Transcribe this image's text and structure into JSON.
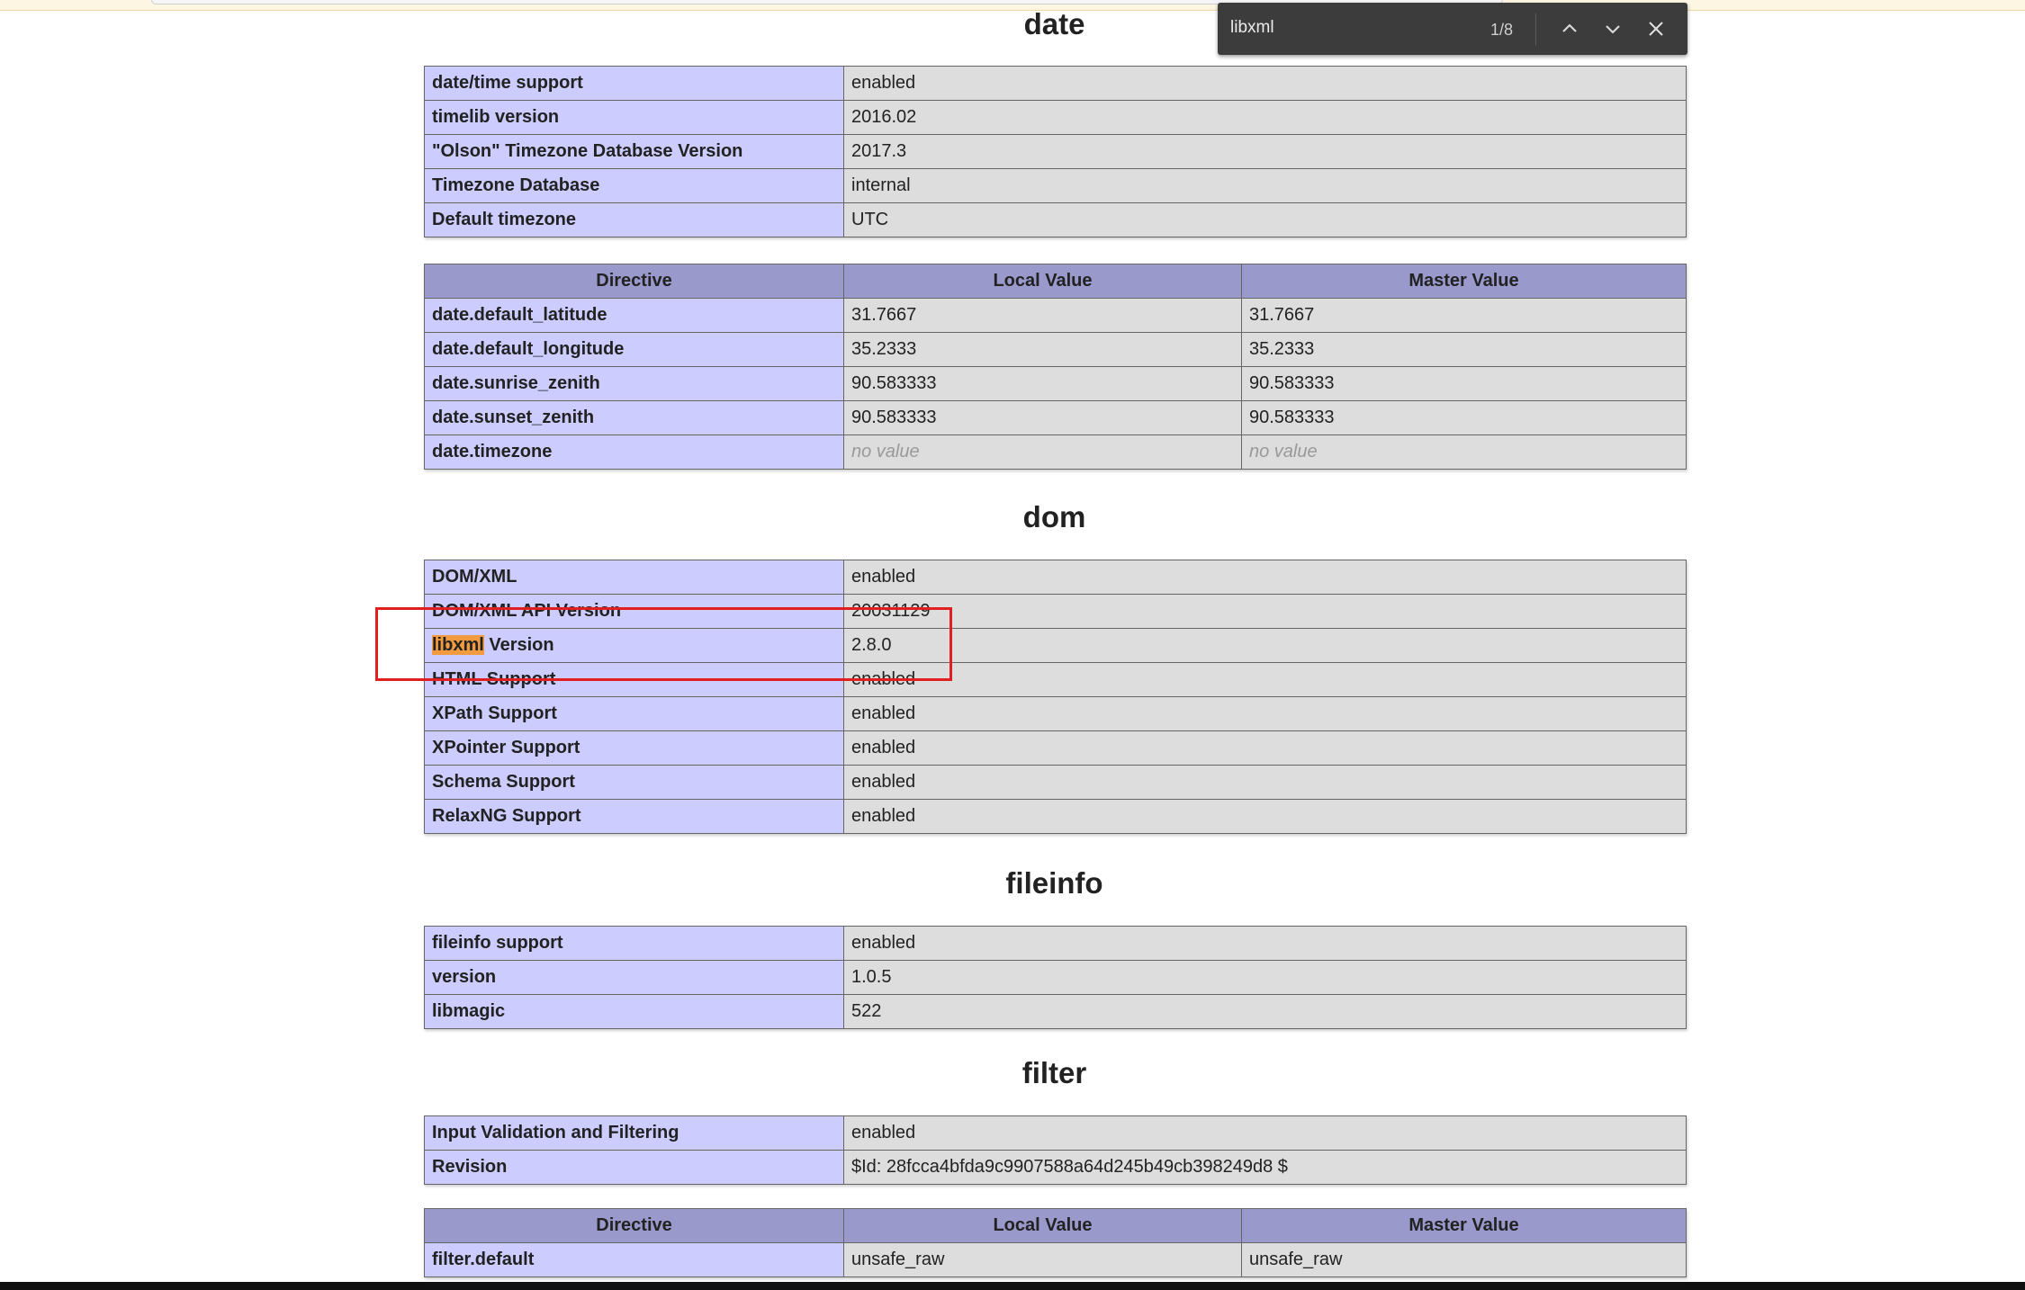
{
  "find_bar": {
    "query": "libxml",
    "match_count": "1/8",
    "prev_icon": "chevron-up-icon",
    "next_icon": "chevron-down-icon",
    "close_icon": "close-icon"
  },
  "sections": {
    "date": {
      "title": "date",
      "info_rows": [
        {
          "key": "date/time support",
          "value": "enabled"
        },
        {
          "key": "timelib version",
          "value": "2016.02"
        },
        {
          "key": "\"Olson\" Timezone Database Version",
          "value": "2017.3"
        },
        {
          "key": "Timezone Database",
          "value": "internal"
        },
        {
          "key": "Default timezone",
          "value": "UTC"
        }
      ],
      "directive_headers": [
        "Directive",
        "Local Value",
        "Master Value"
      ],
      "directives": [
        {
          "name": "date.default_latitude",
          "local": "31.7667",
          "master": "31.7667"
        },
        {
          "name": "date.default_longitude",
          "local": "35.2333",
          "master": "35.2333"
        },
        {
          "name": "date.sunrise_zenith",
          "local": "90.583333",
          "master": "90.583333"
        },
        {
          "name": "date.sunset_zenith",
          "local": "90.583333",
          "master": "90.583333"
        },
        {
          "name": "date.timezone",
          "local": "no value",
          "master": "no value"
        }
      ]
    },
    "dom": {
      "title": "dom",
      "info_rows": [
        {
          "key": "DOM/XML",
          "value": "enabled"
        },
        {
          "key": "DOM/XML API Version",
          "value": "20031129"
        },
        {
          "key_highlight": "libxml",
          "key_rest": " Version",
          "value": "2.8.0"
        },
        {
          "key": "HTML Support",
          "value": "enabled"
        },
        {
          "key": "XPath Support",
          "value": "enabled"
        },
        {
          "key": "XPointer Support",
          "value": "enabled"
        },
        {
          "key": "Schema Support",
          "value": "enabled"
        },
        {
          "key": "RelaxNG Support",
          "value": "enabled"
        }
      ]
    },
    "fileinfo": {
      "title": "fileinfo",
      "info_rows": [
        {
          "key": "fileinfo support",
          "value": "enabled"
        },
        {
          "key": "version",
          "value": "1.0.5"
        },
        {
          "key": "libmagic",
          "value": "522"
        }
      ]
    },
    "filter": {
      "title": "filter",
      "info_rows": [
        {
          "key": "Input Validation and Filtering",
          "value": "enabled"
        },
        {
          "key": "Revision",
          "value": "$Id: 28fcca4bfda9c9907588a64d245b49cb398249d8 $"
        }
      ],
      "directive_headers": [
        "Directive",
        "Local Value",
        "Master Value"
      ],
      "directives": [
        {
          "name": "filter.default",
          "local": "unsafe_raw",
          "master": "unsafe_raw"
        }
      ]
    }
  },
  "colors": {
    "key_cell": "#ccccff",
    "value_cell": "#dddddd",
    "header_cell": "#9999cc",
    "find_highlight": "#f29a3f",
    "annotation_box": "#e02020",
    "find_bar_bg": "#3c3c3c"
  }
}
